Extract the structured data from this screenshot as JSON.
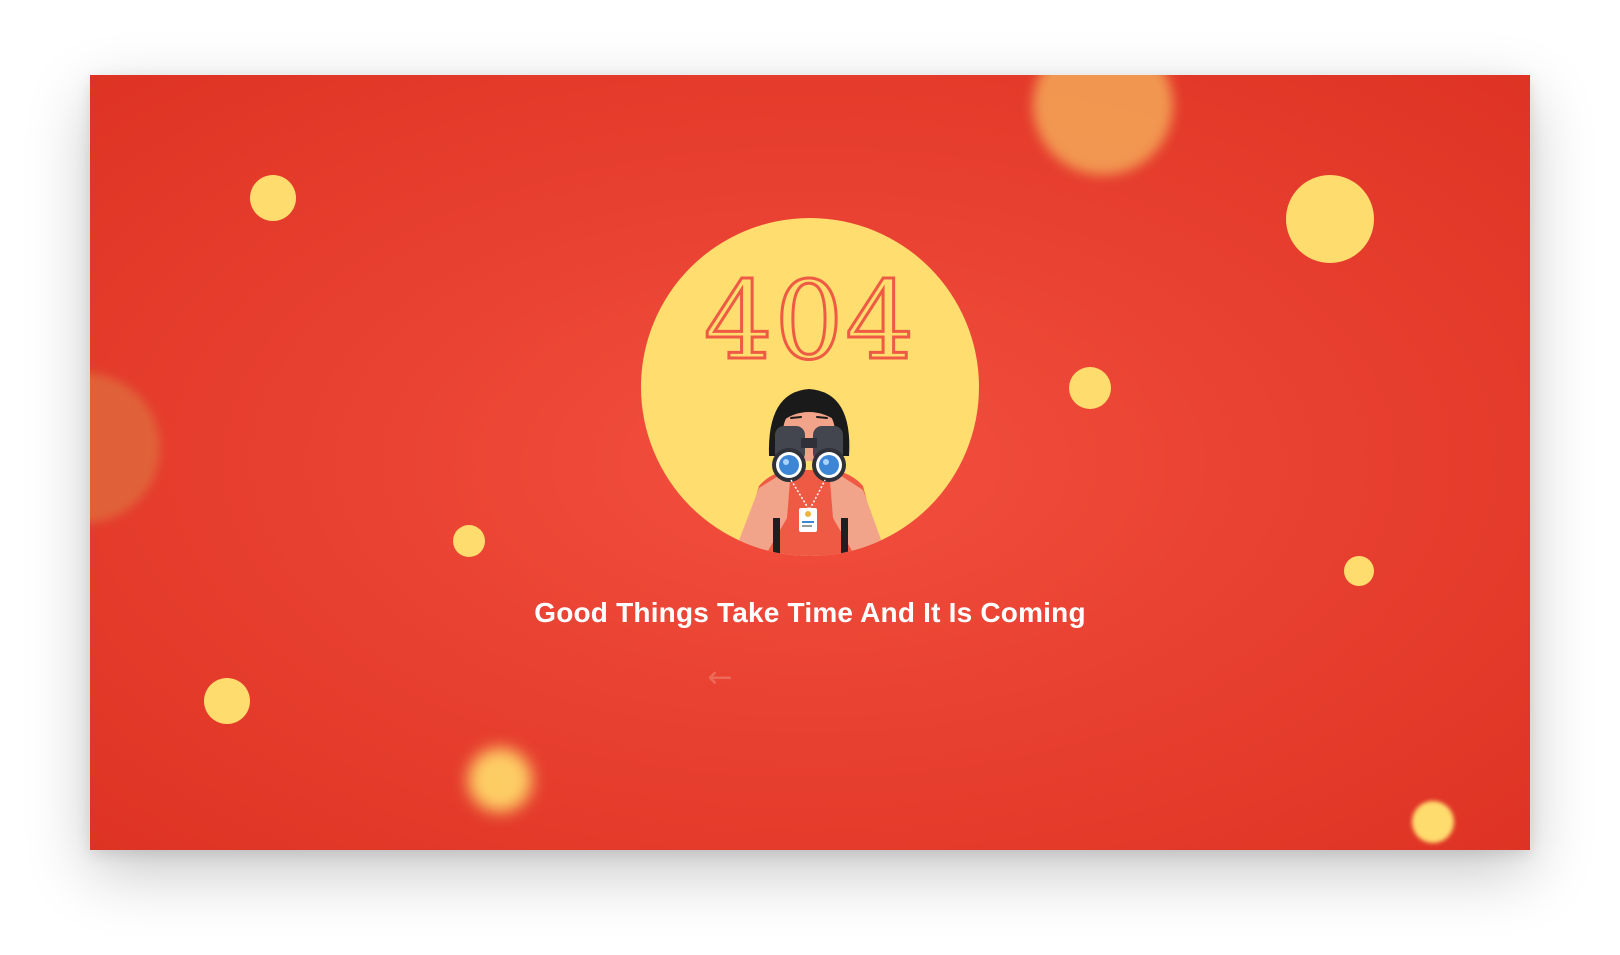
{
  "error_page": {
    "code": "404",
    "headline": "Good Things Take Time And It Is Coming",
    "back_icon": "←"
  },
  "icons": {
    "back": "arrow-left-icon",
    "illustration": "person-with-binoculars-illustration"
  },
  "colors": {
    "background": "#e93e2e",
    "accent_yellow": "#ffdd6f",
    "text": "#ffffff",
    "code_stroke": "#ef5a45",
    "blur_orange": "#f3a155"
  }
}
